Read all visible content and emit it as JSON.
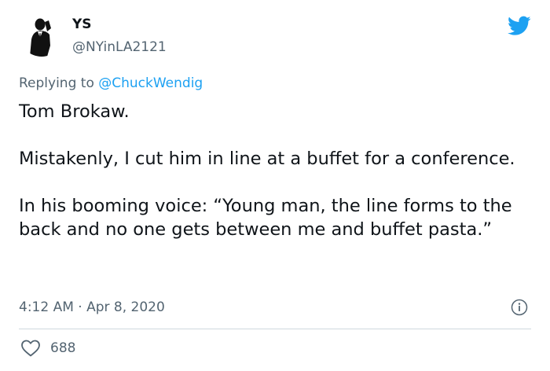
{
  "author": {
    "display_name": "YS",
    "handle": "@NYinLA2121",
    "avatar_icon": "silhouette-man-on-phone-icon"
  },
  "brand": {
    "icon": "twitter-bird-icon",
    "color": "#1da1f2"
  },
  "reply": {
    "prefix": "Replying to",
    "mention": "@ChuckWendig"
  },
  "tweet": {
    "paragraphs": [
      "Tom Brokaw.",
      "Mistakenly, I cut him in line at a buffet for a conference.",
      "In his booming voice: “Young man, the line forms to the back and no one gets between me and buffet pasta.”"
    ]
  },
  "meta": {
    "timestamp": "4:12 AM · Apr 8, 2020",
    "info_icon": "info-icon"
  },
  "engagement": {
    "like_icon": "heart-icon",
    "likes": "688"
  },
  "colors": {
    "text": "#0f1419",
    "secondary": "#536471",
    "link": "#1da1f2",
    "divider": "#cfd9de"
  }
}
